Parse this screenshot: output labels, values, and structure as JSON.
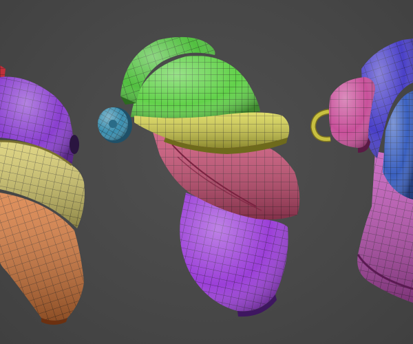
{
  "viewport": {
    "background_color": "#4a4a4a",
    "render_style": "wireframe-over-shaded",
    "wire_color": "#1c1c1c"
  },
  "models": [
    {
      "name": "left-armor-piece",
      "parts": [
        {
          "name": "purple-shell",
          "color": "#8a3fd0"
        },
        {
          "name": "yellow-band",
          "color": "#d8cc6a"
        },
        {
          "name": "orange-lower-plate",
          "color": "#d9793a"
        },
        {
          "name": "red-tab",
          "color": "#c0303a"
        }
      ]
    },
    {
      "name": "center-helmet",
      "parts": [
        {
          "name": "green-crest",
          "color": "#52c040"
        },
        {
          "name": "green-dome",
          "color": "#62d24a"
        },
        {
          "name": "yellow-visor-brim",
          "color": "#d8d44a"
        },
        {
          "name": "blue-ear-disc",
          "color": "#3a8fb0"
        },
        {
          "name": "pink-cheek-guard",
          "color": "#c84a70"
        },
        {
          "name": "purple-neck-guard",
          "color": "#9b3fd8"
        }
      ]
    },
    {
      "name": "right-helmet",
      "parts": [
        {
          "name": "blue-crest",
          "color": "#4a40c8"
        },
        {
          "name": "pink-side-flap",
          "color": "#c8509a"
        },
        {
          "name": "yellow-ring-handle",
          "color": "#c8c040"
        },
        {
          "name": "blue-dome",
          "color": "#3a60c0"
        },
        {
          "name": "pink-lower-guard",
          "color": "#c050b8"
        }
      ]
    }
  ]
}
